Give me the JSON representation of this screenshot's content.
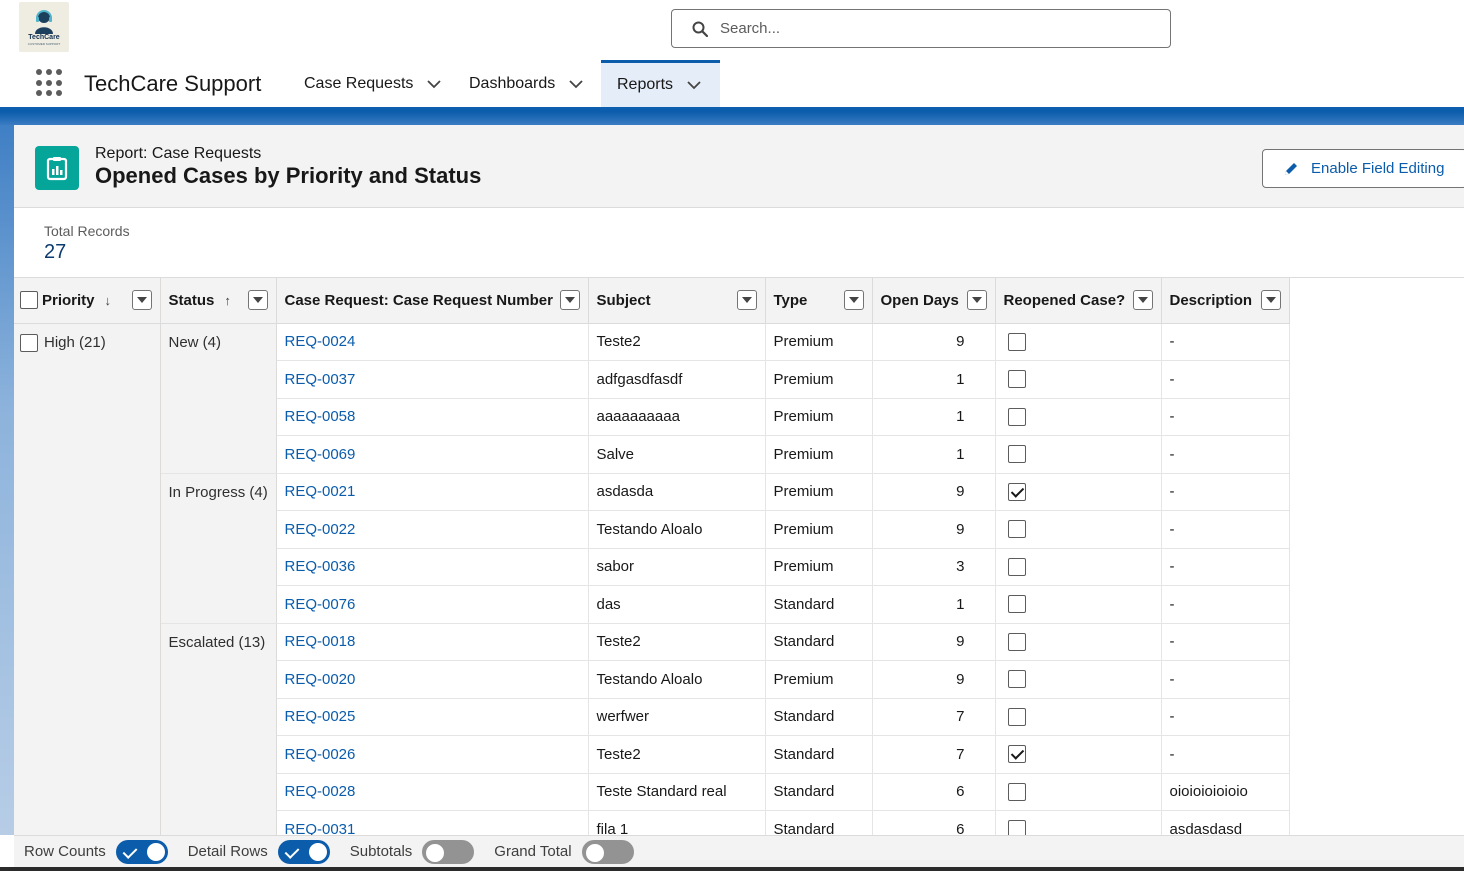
{
  "app": {
    "logo_text": "TechCare",
    "logo_sub": "CUSTOMER SUPPORT",
    "name": "TechCare Support"
  },
  "search": {
    "placeholder": "Search..."
  },
  "nav": {
    "tabs": [
      {
        "label": "Case Requests",
        "active": false
      },
      {
        "label": "Dashboards",
        "active": false
      },
      {
        "label": "Reports",
        "active": true
      }
    ]
  },
  "report": {
    "type_label": "Report: Case Requests",
    "title": "Opened Cases by Priority and Status",
    "enable_editing_label": "Enable Field Editing",
    "icon": "report-icon",
    "accent_color": "#06a59a"
  },
  "summary": {
    "label": "Total Records",
    "value": "27"
  },
  "table": {
    "columns": [
      "Priority",
      "Status",
      "Case Request: Case Request Number",
      "Subject",
      "Type",
      "Open Days",
      "Reopened Case?",
      "Description"
    ],
    "sort": {
      "Priority": "↓",
      "Status": "↑"
    },
    "priority_group": "High (21)",
    "status_groups": [
      {
        "label": "New (4)",
        "rows": [
          {
            "number": "REQ-0024",
            "subject": "Teste2",
            "type": "Premium",
            "open_days": "9",
            "reopened": false,
            "description": "-"
          },
          {
            "number": "REQ-0037",
            "subject": "adfgasdfasdf",
            "type": "Premium",
            "open_days": "1",
            "reopened": false,
            "description": "-"
          },
          {
            "number": "REQ-0058",
            "subject": "aaaaaaaaaa",
            "type": "Premium",
            "open_days": "1",
            "reopened": false,
            "description": "-"
          },
          {
            "number": "REQ-0069",
            "subject": "Salve",
            "type": "Premium",
            "open_days": "1",
            "reopened": false,
            "description": "-"
          }
        ]
      },
      {
        "label": "In Progress (4)",
        "rows": [
          {
            "number": "REQ-0021",
            "subject": "asdasda",
            "type": "Premium",
            "open_days": "9",
            "reopened": true,
            "description": "-"
          },
          {
            "number": "REQ-0022",
            "subject": "Testando Aloalo",
            "type": "Premium",
            "open_days": "9",
            "reopened": false,
            "description": "-"
          },
          {
            "number": "REQ-0036",
            "subject": "sabor",
            "type": "Premium",
            "open_days": "3",
            "reopened": false,
            "description": "-"
          },
          {
            "number": "REQ-0076",
            "subject": "das",
            "type": "Standard",
            "open_days": "1",
            "reopened": false,
            "description": "-"
          }
        ]
      },
      {
        "label": "Escalated (13)",
        "rows": [
          {
            "number": "REQ-0018",
            "subject": "Teste2",
            "type": "Standard",
            "open_days": "9",
            "reopened": false,
            "description": "-"
          },
          {
            "number": "REQ-0020",
            "subject": "Testando Aloalo",
            "type": "Premium",
            "open_days": "9",
            "reopened": false,
            "description": "-"
          },
          {
            "number": "REQ-0025",
            "subject": "werfwer",
            "type": "Standard",
            "open_days": "7",
            "reopened": false,
            "description": "-"
          },
          {
            "number": "REQ-0026",
            "subject": "Teste2",
            "type": "Standard",
            "open_days": "7",
            "reopened": true,
            "description": "-"
          },
          {
            "number": "REQ-0028",
            "subject": "Teste Standard real",
            "type": "Standard",
            "open_days": "6",
            "reopened": false,
            "description": "oioioioioioio"
          },
          {
            "number": "REQ-0031",
            "subject": "fila 1",
            "type": "Standard",
            "open_days": "6",
            "reopened": false,
            "description": "asdasdasd"
          }
        ]
      }
    ]
  },
  "footer": {
    "toggles": [
      {
        "label": "Row Counts",
        "on": true
      },
      {
        "label": "Detail Rows",
        "on": true
      },
      {
        "label": "Subtotals",
        "on": false
      },
      {
        "label": "Grand Total",
        "on": false
      }
    ]
  },
  "colors": {
    "link": "#0b5cab",
    "brand_blue": "#0b5cab",
    "report_icon": "#06a59a"
  }
}
